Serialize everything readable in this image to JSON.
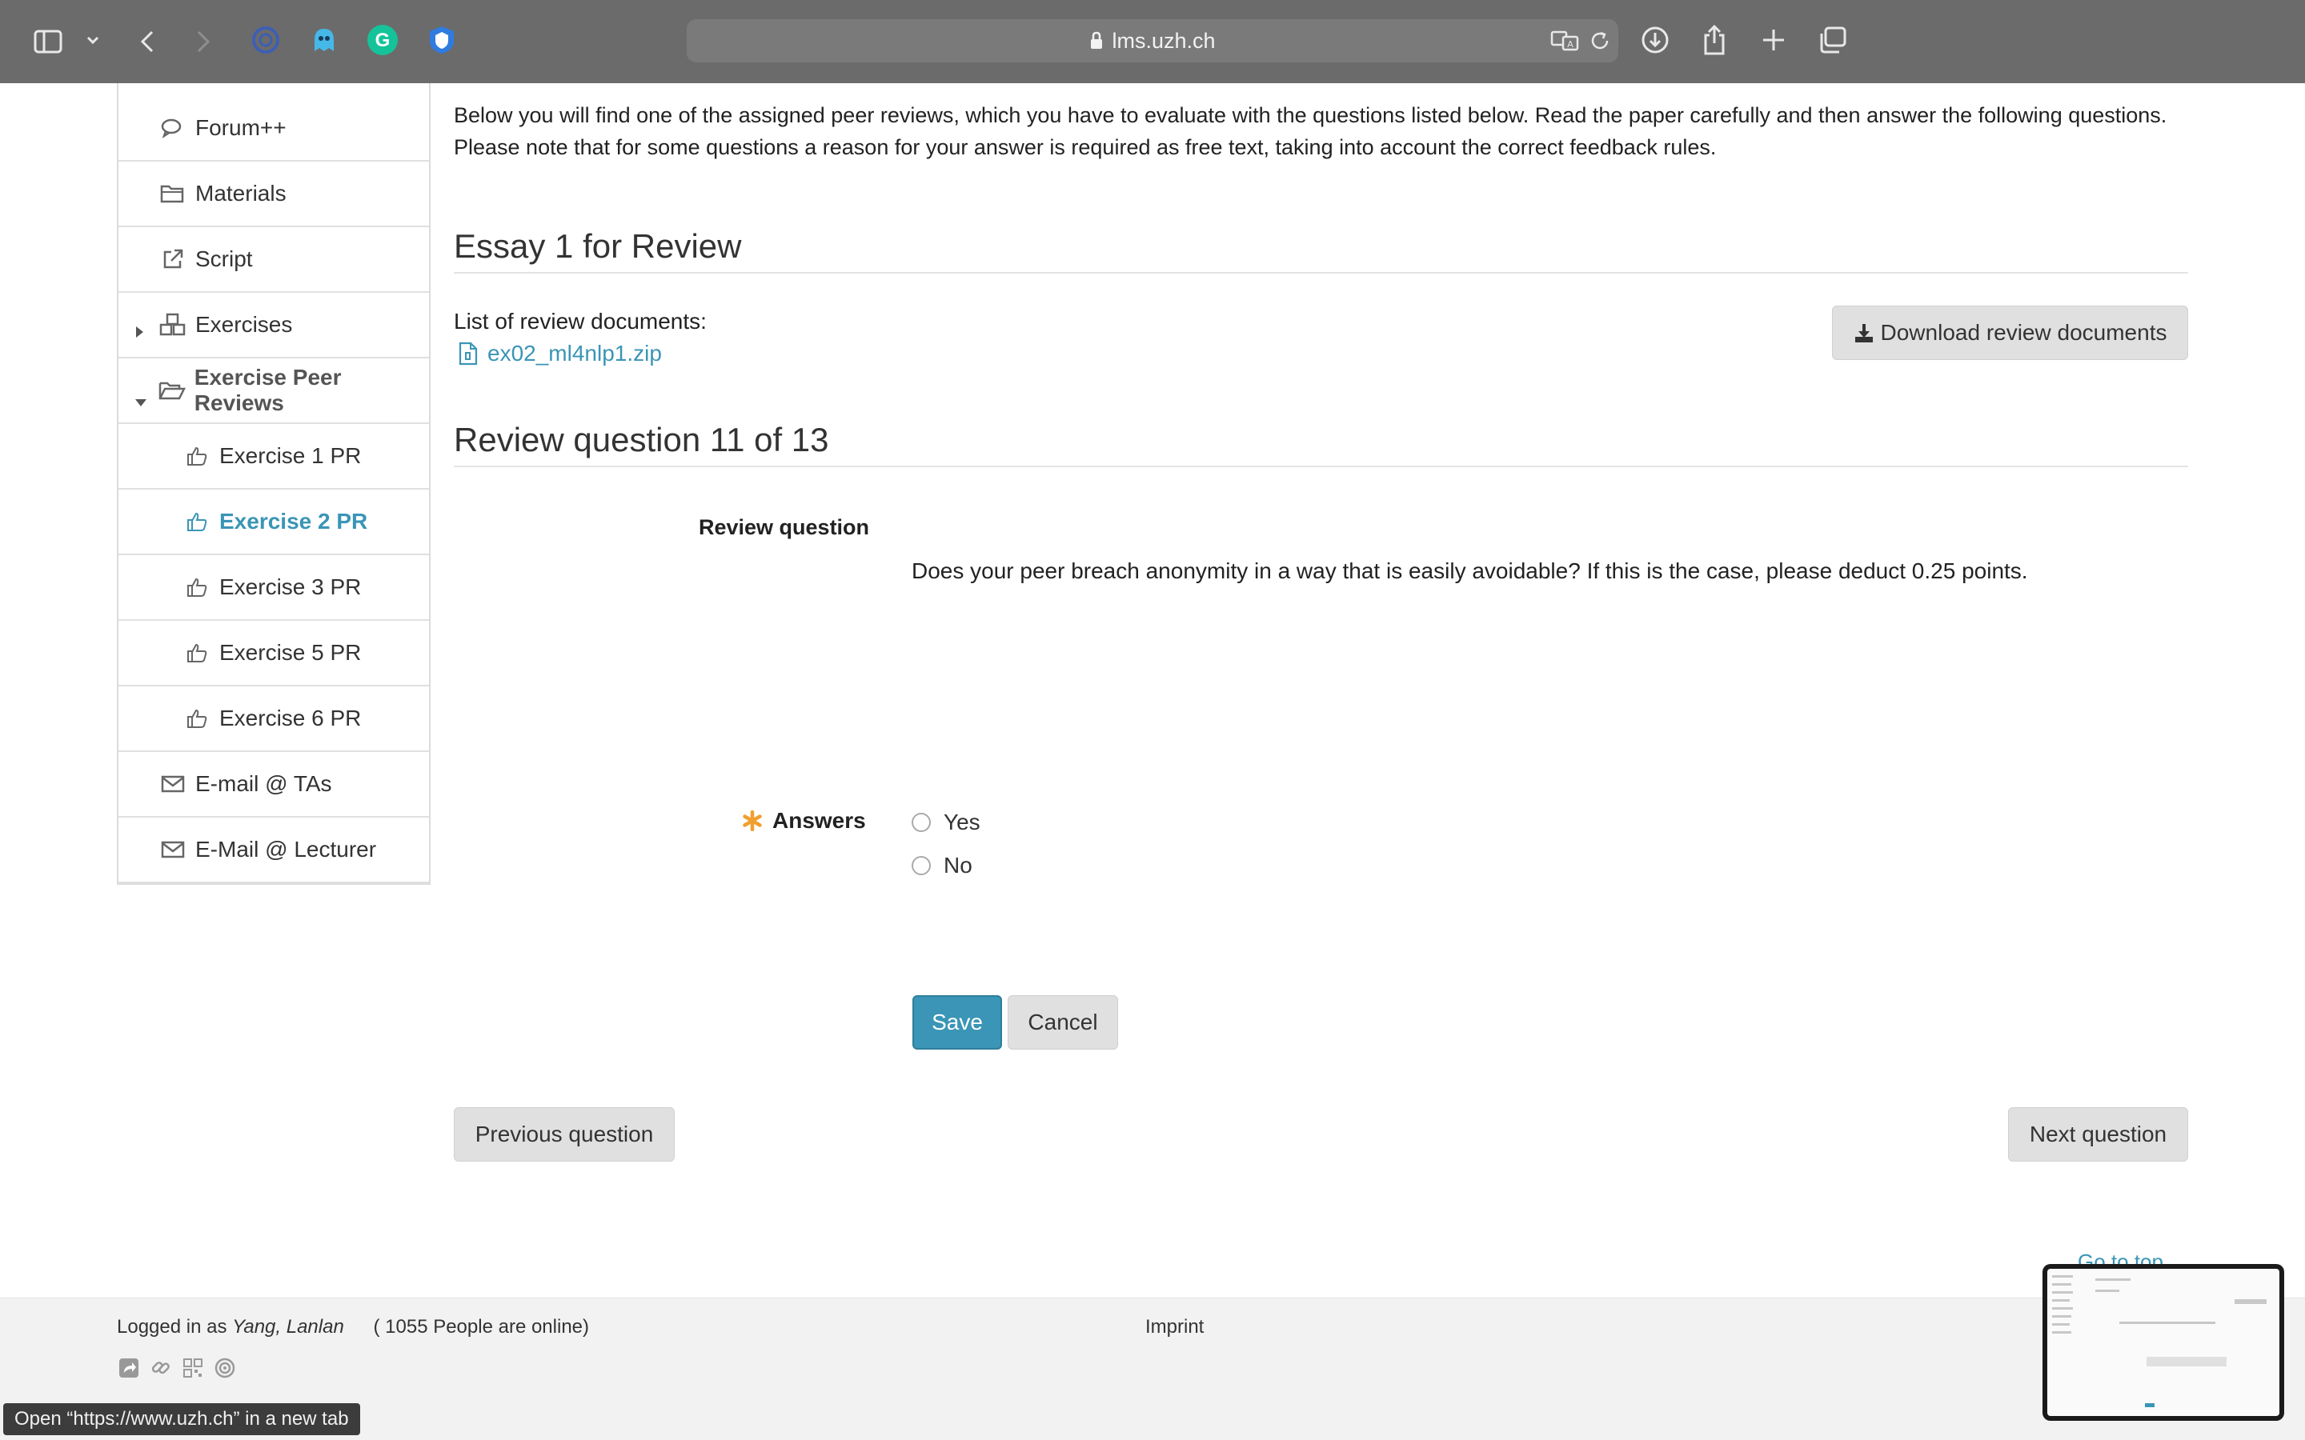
{
  "browser": {
    "url": "lms.uzh.ch",
    "icons": [
      "sidebar-icon",
      "chevron-down-icon",
      "back-icon",
      "forward-icon",
      "extension-1-icon",
      "extension-ghost-icon",
      "grammarly-icon",
      "extension-shield-icon",
      "translate-icon",
      "reload-icon",
      "download-icon",
      "share-icon",
      "new-tab-icon",
      "tabs-overview-icon"
    ]
  },
  "sidebar": {
    "items": [
      {
        "label": "Forum++",
        "icon": "forum-icon"
      },
      {
        "label": "Materials",
        "icon": "folder-icon"
      },
      {
        "label": "Script",
        "icon": "external-link-icon"
      },
      {
        "label": "Exercises",
        "icon": "cubes-icon"
      },
      {
        "label": "Exercise Peer Reviews",
        "icon": "folder-open-icon"
      },
      {
        "label": "Exercise 1 PR",
        "icon": "thumbs-up-icon"
      },
      {
        "label": "Exercise 2 PR",
        "icon": "thumbs-up-icon"
      },
      {
        "label": "Exercise 3 PR",
        "icon": "thumbs-up-icon"
      },
      {
        "label": "Exercise 5 PR",
        "icon": "thumbs-up-icon"
      },
      {
        "label": "Exercise 6 PR",
        "icon": "thumbs-up-icon"
      },
      {
        "label": "E-mail @ TAs",
        "icon": "envelope-icon"
      },
      {
        "label": "E-Mail @ Lecturer",
        "icon": "envelope-icon"
      }
    ]
  },
  "main": {
    "intro": "Below you will find one of the assigned peer reviews, which you have to evaluate with the questions listed below. Read the paper carefully and then answer the following questions. Please note that for some questions a reason for your answer is required as free text, taking into account the correct feedback rules.",
    "essay_title": "Essay 1 for Review",
    "doclist_label": "List of review documents:",
    "doc_file": "ex02_ml4nlp1.zip",
    "download_label": "Download review documents",
    "review_header": "Review question 11 of 13",
    "rq_label": "Review question",
    "rq_text": "Does your peer breach anonymity in a way that is easily avoidable? If this is the case, please deduct 0.25 points.",
    "answers_label": "Answers",
    "options": [
      "Yes",
      "No"
    ],
    "save_label": "Save",
    "cancel_label": "Cancel",
    "prev_label": "Previous question",
    "next_label": "Next question",
    "goto_top": "Go to top"
  },
  "footer": {
    "logged_prefix": "Logged in as",
    "user": "Yang, Lanlan",
    "online": "( 1055 People are online)",
    "imprint": "Imprint",
    "status_tooltip": "Open “https://www.uzh.ch” in a new tab"
  },
  "colors": {
    "accent": "#3a95b6",
    "toolbar": "#6b6b6b",
    "required": "#f0a030"
  }
}
